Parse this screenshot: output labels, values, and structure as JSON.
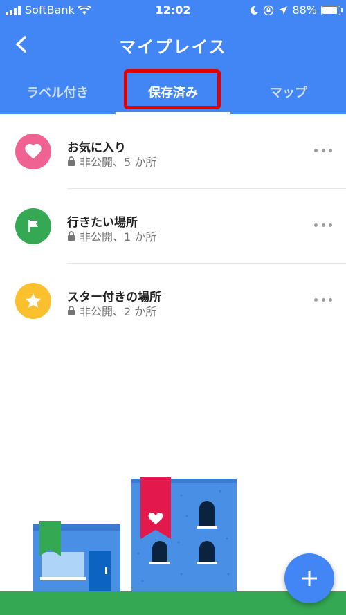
{
  "status_bar": {
    "carrier": "SoftBank",
    "time": "12:02",
    "battery": "88%",
    "battery_level": 0.88
  },
  "header": {
    "title": "マイプレイス"
  },
  "tabs": [
    {
      "label": "ラベル付き"
    },
    {
      "label": "保存済み",
      "selected": true
    },
    {
      "label": "マップ"
    }
  ],
  "lists": [
    {
      "name": "お気に入り",
      "detail": "非公開、5 か所",
      "icon": "heart-icon",
      "color": "#f06292"
    },
    {
      "name": "行きたい場所",
      "detail": "非公開、1 か所",
      "icon": "flag-icon",
      "color": "#34a853"
    },
    {
      "name": "スター付きの場所",
      "detail": "非公開、2 か所",
      "icon": "star-icon",
      "color": "#fbc02d"
    }
  ],
  "colors": {
    "header": "#4285f4",
    "highlight": "#e00000",
    "fab": "#4285f4"
  }
}
